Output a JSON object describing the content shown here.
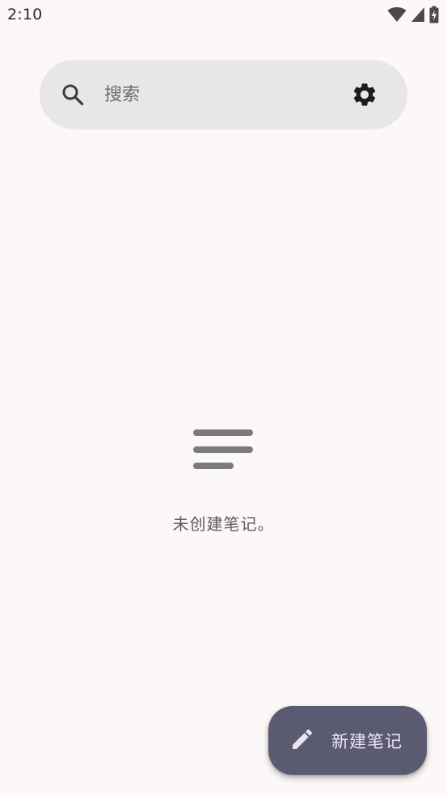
{
  "status_bar": {
    "time": "2:10",
    "icons": [
      "wifi-icon",
      "signal-icon",
      "battery-charging-icon"
    ]
  },
  "search": {
    "placeholder": "搜索",
    "value": "",
    "icon": "search-icon",
    "settings_icon": "gear-icon"
  },
  "empty_state": {
    "icon": "notes-lines-icon",
    "message": "未创建笔记。"
  },
  "fab": {
    "icon": "pencil-icon",
    "label": "新建笔记"
  },
  "colors": {
    "background": "#fcf8f8",
    "search_bar": "#e8e6e7",
    "fab_background": "#5a5a70",
    "fab_text": "#e9e4f0",
    "muted_text": "#5e5a5f",
    "icon_gray": "#7a7a7a"
  }
}
